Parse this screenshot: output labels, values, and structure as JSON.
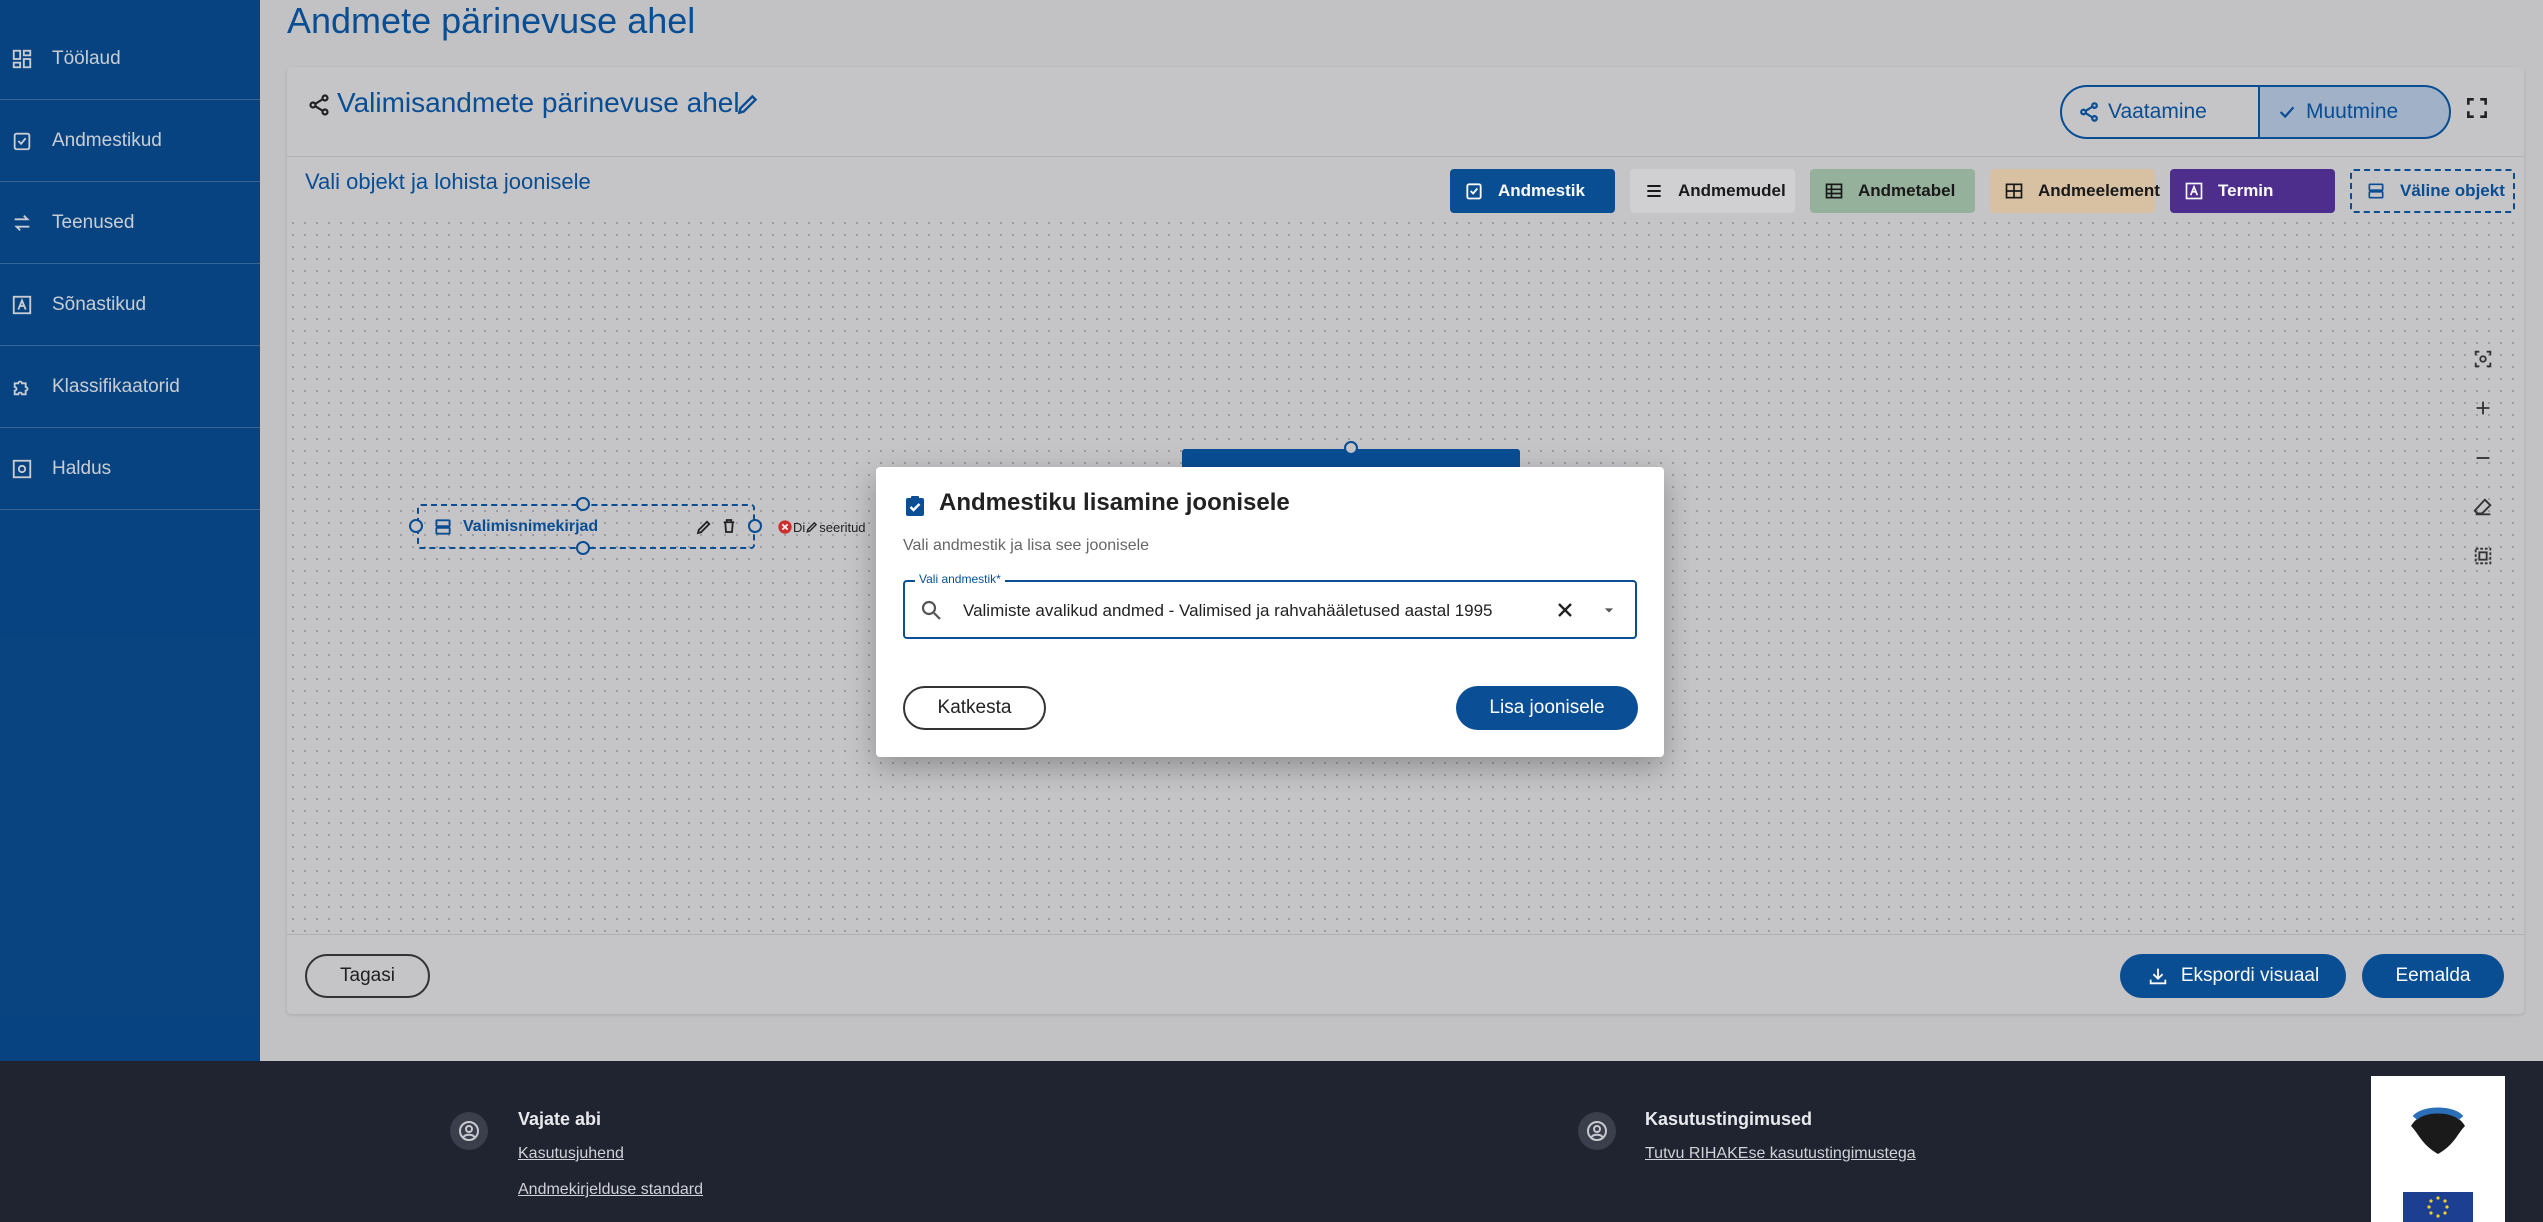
{
  "page": {
    "title": "Andmete pärinevuse ahel"
  },
  "sidebar": {
    "items": [
      {
        "label": "Töölaud",
        "icon": "dashboard-icon"
      },
      {
        "label": "Andmestikud",
        "icon": "checklist-icon"
      },
      {
        "label": "Teenused",
        "icon": "swap-arrows-icon"
      },
      {
        "label": "Sõnastikud",
        "icon": "letter-a-box-icon"
      },
      {
        "label": "Klassifikaatorid",
        "icon": "puzzle-icon"
      },
      {
        "label": "Haldus",
        "icon": "settings-box-icon"
      }
    ]
  },
  "card": {
    "title": "Valimisandmete pärinevuse ahel",
    "mode_view": "Vaatamine",
    "mode_edit": "Muutmine",
    "instruction": "Vali objekt ja lohista joonisele"
  },
  "object_types": [
    {
      "label": "Andmestik",
      "bg": "#0a4f96",
      "fg": "#ffffff"
    },
    {
      "label": "Andmemudel",
      "bg": "#d5d5d8",
      "fg": "#1a1a1a"
    },
    {
      "label": "Andmetabel",
      "bg": "#99b59f",
      "fg": "#1a1a1a"
    },
    {
      "label": "Andmeelement",
      "bg": "#dcc5a6",
      "fg": "#1a1a1a"
    },
    {
      "label": "Termin",
      "bg": "#4f2f90",
      "fg": "#ffffff"
    },
    {
      "label": "Väline objekt",
      "bg": "#c9c9cc",
      "fg": "#0a4f96"
    }
  ],
  "node": {
    "label": "Valimisnimekirjad",
    "edge_text": "Di",
    "edge_text_2": "seeritud"
  },
  "actions": {
    "back": "Tagasi",
    "export": "Ekspordi visuaal",
    "remove": "Eemalda"
  },
  "footer": {
    "help_heading": "Vajate abi",
    "help_links": [
      "Kasutusjuhend",
      "Andmekirjelduse standard"
    ],
    "terms_heading": "Kasutustingimused",
    "terms_link": "Tutvu RIHAKEse kasutustingimustega"
  },
  "modal": {
    "title": "Andmestiku lisamine joonisele",
    "subtitle": "Vali andmestik ja lisa see joonisele",
    "field_label": "Vali andmestik*",
    "field_value": "Valimiste avalikud andmed - Valimised ja rahvahääletused aastal 1995",
    "cancel": "Katkesta",
    "confirm": "Lisa joonisele"
  },
  "colors": {
    "primary": "#0a4f96",
    "footer_bg": "#1f2430"
  }
}
